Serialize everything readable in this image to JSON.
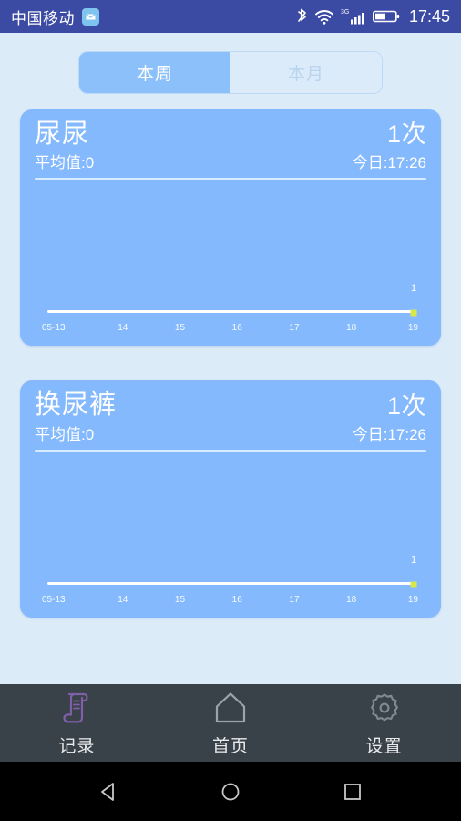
{
  "status_bar": {
    "carrier": "中国移动",
    "carrier_icon": "mail-badge-icon",
    "bluetooth_icon": "bluetooth-icon",
    "wifi_icon": "wifi-icon",
    "network_type": "3G",
    "signal_icon": "signal-bars-icon",
    "battery_icon": "battery-icon",
    "time": "17:45",
    "background": "#3b4aa2"
  },
  "tabs": {
    "items": [
      {
        "label": "本周",
        "selected": true
      },
      {
        "label": "本月",
        "selected": false
      }
    ],
    "active_color": "#8cc0fa",
    "inactive_color": "#dcebfa"
  },
  "cards": [
    {
      "title": "尿尿",
      "average": "平均值:0",
      "count": "1次",
      "today": "今日:17:26",
      "chart_data": {
        "type": "line",
        "title": "尿尿",
        "categories": [
          "05-13",
          "14",
          "15",
          "16",
          "17",
          "18",
          "19"
        ],
        "values": [
          0,
          0,
          0,
          0,
          0,
          0,
          1
        ],
        "point_labels": [
          "",
          "",
          "",
          "",
          "",
          "",
          "1"
        ],
        "xlabel": "",
        "ylabel": "",
        "ylim": [
          0,
          1
        ],
        "grid": false,
        "legend": "none",
        "point_color": "#d8e84a",
        "axis_color": "#ffffff"
      }
    },
    {
      "title": "换尿裤",
      "average": "平均值:0",
      "count": "1次",
      "today": "今日:17:26",
      "chart_data": {
        "type": "line",
        "title": "换尿裤",
        "categories": [
          "05-13",
          "14",
          "15",
          "16",
          "17",
          "18",
          "19"
        ],
        "values": [
          0,
          0,
          0,
          0,
          0,
          0,
          1
        ],
        "point_labels": [
          "",
          "",
          "",
          "",
          "",
          "",
          "1"
        ],
        "xlabel": "",
        "ylabel": "",
        "ylim": [
          0,
          1
        ],
        "grid": false,
        "legend": "none",
        "point_color": "#d8e84a",
        "axis_color": "#ffffff"
      }
    }
  ],
  "bottom_nav": {
    "items": [
      {
        "label": "记录",
        "icon": "scroll-record-icon",
        "active": true
      },
      {
        "label": "首页",
        "icon": "home-icon",
        "active": false
      },
      {
        "label": "设置",
        "icon": "gear-icon",
        "active": false
      }
    ],
    "background": "#3a4249",
    "active_icon_color": "#7e5fa8",
    "inactive_icon_color": "#6d787f"
  },
  "system_bar": {
    "back": "back-triangle-icon",
    "home": "home-circle-icon",
    "recents": "recents-square-icon"
  },
  "theme": {
    "page_background": "#dcebf8",
    "card_background": "#84b9fd"
  }
}
